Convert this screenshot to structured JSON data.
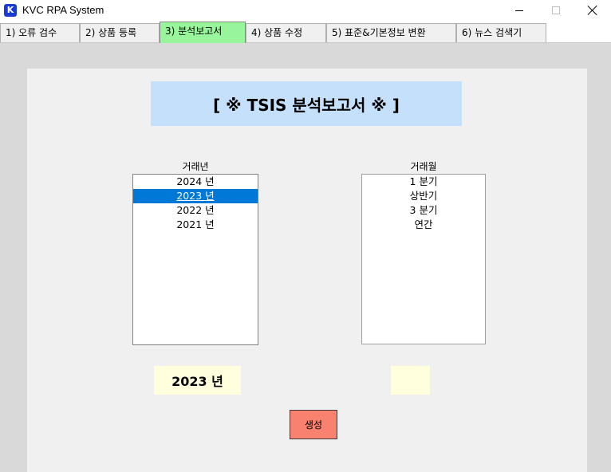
{
  "window": {
    "app_icon": "K",
    "title": "KVC RPA System",
    "controls": [
      "minimize-icon",
      "maximize-icon",
      "close-icon"
    ]
  },
  "tabs": [
    {
      "label": "1)  오류 검수",
      "active": false
    },
    {
      "label": "2)  상품 등록",
      "active": false
    },
    {
      "label": "3)  분석보고서",
      "active": true
    },
    {
      "label": "4)  상품 수정",
      "active": false
    },
    {
      "label": "5)  표준&기본정보 변환",
      "active": false
    },
    {
      "label": "6)  뉴스 검색기",
      "active": false
    }
  ],
  "banner": {
    "text": "[ ※ TSIS 분석보고서 ※ ]"
  },
  "year_list": {
    "caption": "거래년",
    "items": [
      "2024 년",
      "2023 년",
      "2022 년",
      "2021 년"
    ],
    "selected": "2023 년"
  },
  "month_list": {
    "caption": "거래월",
    "items": [
      "1 분기",
      "상반기",
      "3 분기",
      "연간"
    ],
    "selected": null
  },
  "displays": {
    "year": "2023 년",
    "month": ""
  },
  "generate_button": {
    "label": "생성"
  },
  "colors": {
    "active_tab": "#99f59b",
    "banner_bg": "#c5e0fa",
    "display_bg": "#ffffdd",
    "generate_bg": "#f8816f",
    "selection": "#0078d7"
  }
}
